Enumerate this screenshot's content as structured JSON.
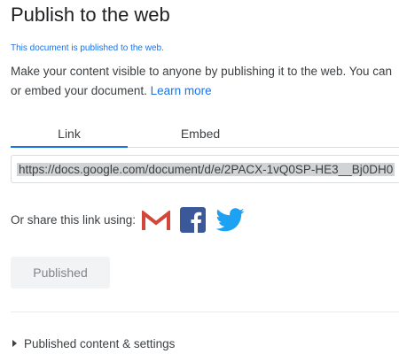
{
  "dialog": {
    "title": "Publish to the web",
    "status_note": "This document is published to the web.",
    "description_line1": "Make your content visible to anyone by publishing it to the web. You can",
    "description_line2_prefix": "or embed your document.",
    "learn_more": "Learn more"
  },
  "tabs": [
    {
      "label": "Link",
      "active": true
    },
    {
      "label": "Embed",
      "active": false
    }
  ],
  "link": {
    "url": "https://docs.google.com/document/d/e/2PACX-1vQ0SP-HE3__Bj0DH0"
  },
  "share": {
    "label": "Or share this link using:",
    "services": [
      {
        "icon": "gmail-icon",
        "color": "#d44638"
      },
      {
        "icon": "facebook-icon",
        "color": "#3b5998"
      },
      {
        "icon": "twitter-icon",
        "color": "#1da1f2"
      }
    ]
  },
  "publish_button": {
    "label": "Published"
  },
  "settings": {
    "label": "Published content & settings"
  },
  "colors": {
    "accent": "#1a73e8"
  }
}
